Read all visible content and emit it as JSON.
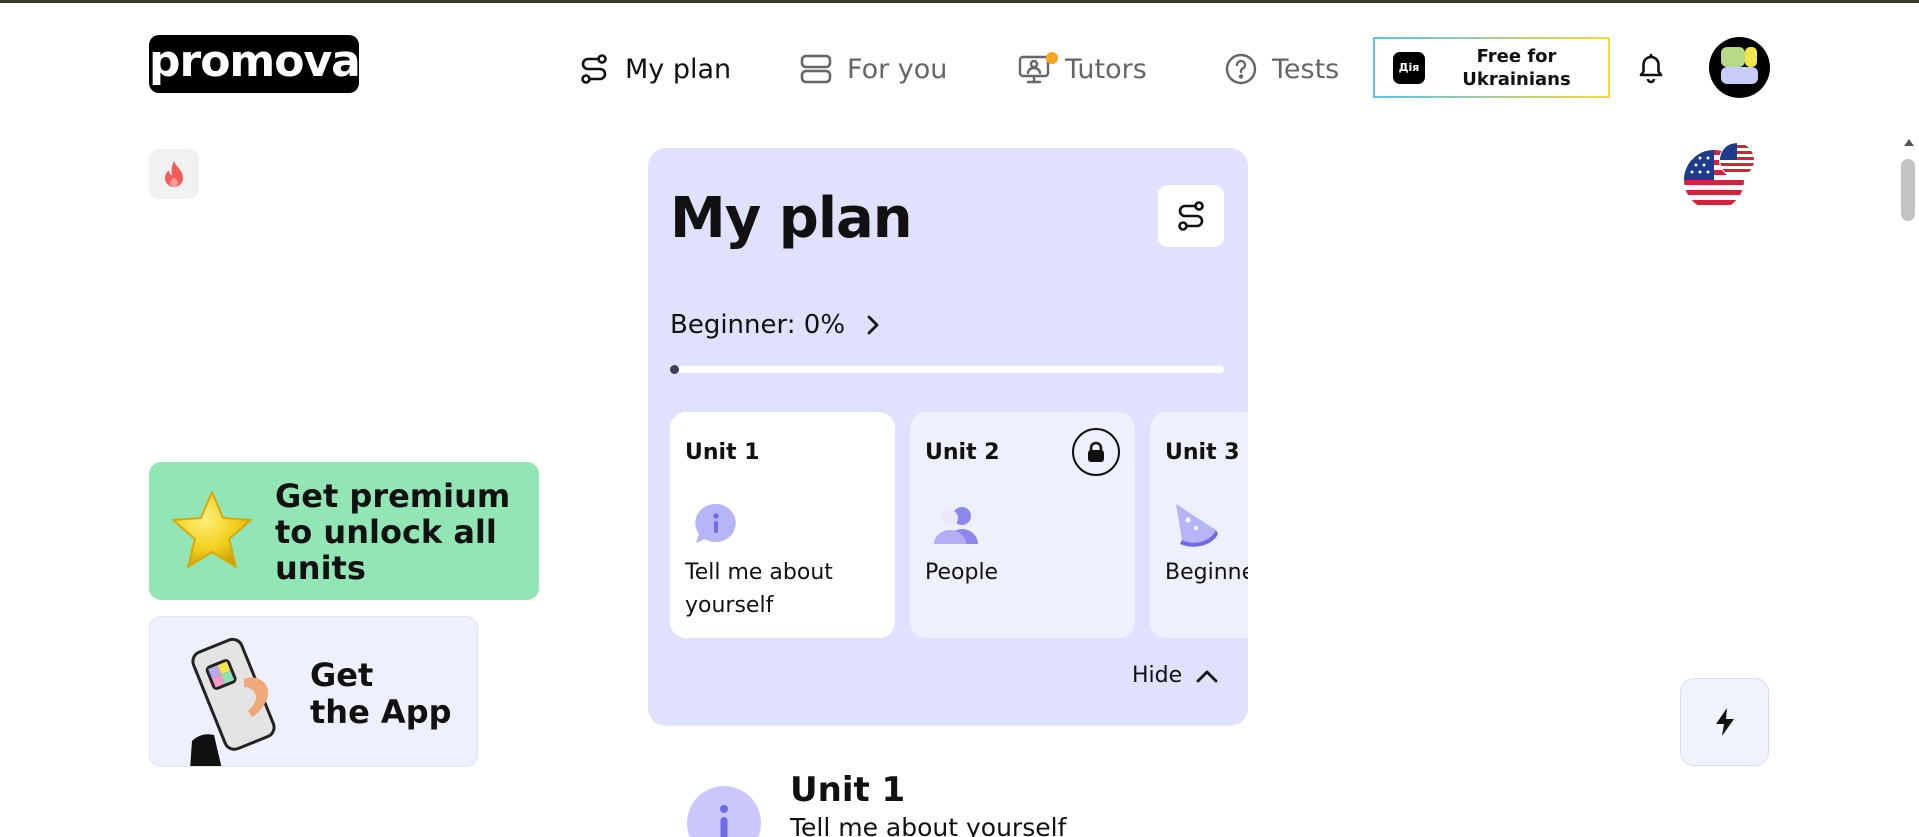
{
  "header": {
    "logo": "promova",
    "nav": [
      {
        "label": "My plan",
        "icon": "route-icon",
        "active": true
      },
      {
        "label": "For you",
        "icon": "layers-icon",
        "active": false
      },
      {
        "label": "Tutors",
        "icon": "tutor-screen-icon",
        "active": false
      },
      {
        "label": "Tests",
        "icon": "question-circle-icon",
        "active": false
      }
    ],
    "free_button": {
      "badge": "Дія",
      "label_line1": "Free for",
      "label_line2": "Ukrainians"
    }
  },
  "sidebar": {
    "premium_line1": "Get premium",
    "premium_line2": "to unlock all",
    "premium_line3": "units",
    "app_line1": "Get",
    "app_line2": "the App"
  },
  "plan": {
    "title": "My plan",
    "level_label": "Beginner: 0%",
    "progress_fraction": 0.0,
    "units": [
      {
        "title": "Unit 1",
        "name": "Tell me about yourself",
        "locked": false
      },
      {
        "title": "Unit 2",
        "name": "People",
        "locked": true
      },
      {
        "title": "Unit 3",
        "name": "Beginne",
        "locked": true
      }
    ],
    "hide_label": "Hide"
  },
  "bottom_unit": {
    "title": "Unit 1",
    "subtitle": "Tell me about yourself"
  },
  "colors": {
    "plan_bg": "#dfe1fd",
    "premium_bg": "#92e6b6",
    "tutors_badge": "#f6a623",
    "streak_flame": "#f45b5b"
  }
}
